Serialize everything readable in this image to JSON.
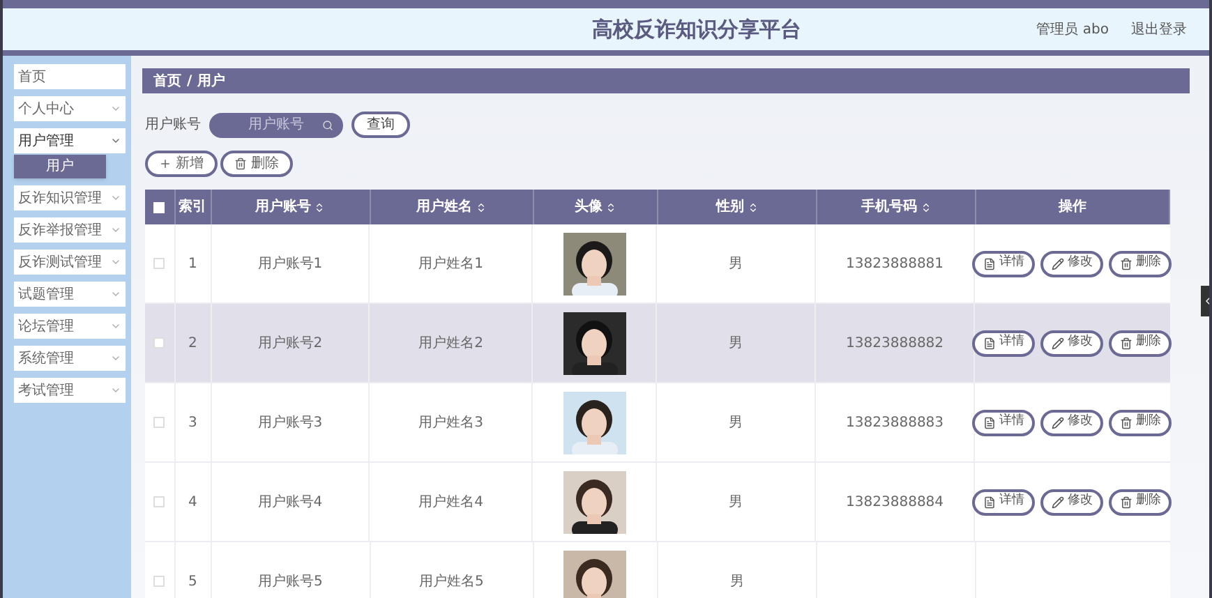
{
  "header": {
    "title": "高校反诈知识分享平台",
    "user": "管理员 abo",
    "logout": "退出登录"
  },
  "sidebar": {
    "items": [
      {
        "label": "首页",
        "expandable": false,
        "expanded": false
      },
      {
        "label": "个人中心",
        "expandable": true,
        "expanded": false
      },
      {
        "label": "用户管理",
        "expandable": true,
        "expanded": true,
        "children": [
          {
            "label": "用户",
            "selected": true
          }
        ]
      },
      {
        "label": "反诈知识管理",
        "expandable": true,
        "expanded": false
      },
      {
        "label": "反诈举报管理",
        "expandable": true,
        "expanded": false
      },
      {
        "label": "反诈测试管理",
        "expandable": true,
        "expanded": false
      },
      {
        "label": "试题管理",
        "expandable": true,
        "expanded": false
      },
      {
        "label": "论坛管理",
        "expandable": true,
        "expanded": false
      },
      {
        "label": "系统管理",
        "expandable": true,
        "expanded": false
      },
      {
        "label": "考试管理",
        "expandable": true,
        "expanded": false
      }
    ]
  },
  "breadcrumb": [
    "首页",
    "用户"
  ],
  "breadcrumb_separator": "/",
  "search": {
    "label": "用户账号",
    "placeholder": "用户账号",
    "button": "查询"
  },
  "toolbar": [
    {
      "kind": "add",
      "label": "新增"
    },
    {
      "kind": "delete",
      "label": "删除"
    }
  ],
  "table": {
    "columns": [
      {
        "label": "索引",
        "sortable": false
      },
      {
        "label": "用户账号",
        "sortable": true
      },
      {
        "label": "用户姓名",
        "sortable": true
      },
      {
        "label": "头像",
        "sortable": true
      },
      {
        "label": "性别",
        "sortable": true
      },
      {
        "label": "手机号码",
        "sortable": true
      },
      {
        "label": "操作",
        "sortable": false
      }
    ],
    "header_checked": false,
    "rows": [
      {
        "index": "1",
        "account": "用户账号1",
        "name": "用户姓名1",
        "gender": "男",
        "phone": "13823888881",
        "checked": false,
        "highlighted": false,
        "actions": [
          {
            "kind": "detail",
            "label": "详情"
          },
          {
            "kind": "edit",
            "label": "修改"
          },
          {
            "kind": "delete",
            "label": "删除"
          }
        ]
      },
      {
        "index": "2",
        "account": "用户账号2",
        "name": "用户姓名2",
        "gender": "男",
        "phone": "13823888882",
        "checked": false,
        "highlighted": true,
        "actions": [
          {
            "kind": "detail",
            "label": "详情"
          },
          {
            "kind": "edit",
            "label": "修改"
          },
          {
            "kind": "delete",
            "label": "删除"
          }
        ]
      },
      {
        "index": "3",
        "account": "用户账号3",
        "name": "用户姓名3",
        "gender": "男",
        "phone": "13823888883",
        "checked": false,
        "highlighted": false,
        "actions": [
          {
            "kind": "detail",
            "label": "详情"
          },
          {
            "kind": "edit",
            "label": "修改"
          },
          {
            "kind": "delete",
            "label": "删除"
          }
        ]
      },
      {
        "index": "4",
        "account": "用户账号4",
        "name": "用户姓名4",
        "gender": "男",
        "phone": "13823888884",
        "checked": false,
        "highlighted": false,
        "actions": [
          {
            "kind": "detail",
            "label": "详情"
          },
          {
            "kind": "edit",
            "label": "修改"
          },
          {
            "kind": "delete",
            "label": "删除"
          }
        ]
      },
      {
        "index": "5",
        "account": "用户账号5",
        "name": "用户姓名5",
        "gender": "男",
        "checked": false,
        "highlighted": false
      }
    ]
  }
}
